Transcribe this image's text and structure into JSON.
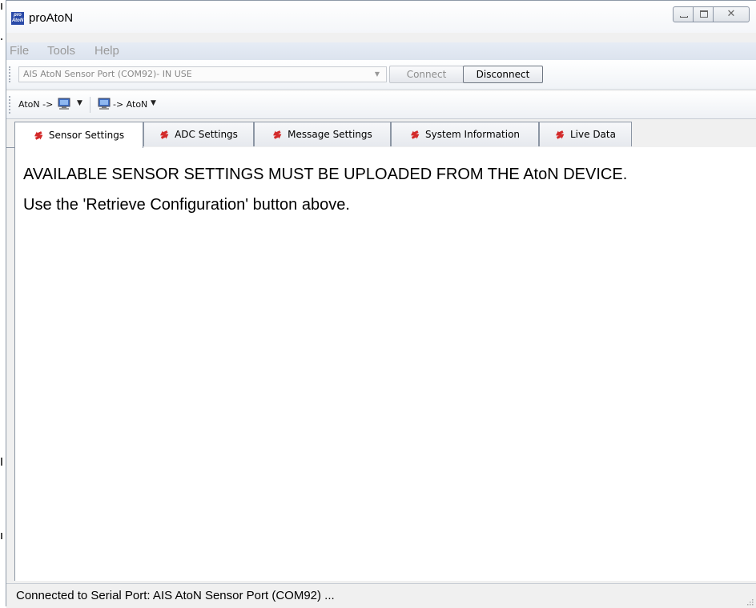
{
  "window": {
    "title": "proAtoN",
    "icon_text_top": "pro",
    "icon_text_bottom": "AtoN"
  },
  "menu": {
    "items": [
      "File",
      "Tools",
      "Help"
    ]
  },
  "connection_toolbar": {
    "port_value": "AIS AtoN Sensor Port (COM92)- IN USE",
    "connect_label": "Connect",
    "disconnect_label": "Disconnect"
  },
  "transfer_toolbar": {
    "download_label": "AtoN ->",
    "upload_label": "-> AtoN"
  },
  "tabs": [
    {
      "label": "Sensor Settings",
      "active": true
    },
    {
      "label": "ADC Settings",
      "active": false
    },
    {
      "label": "Message Settings",
      "active": false
    },
    {
      "label": "System Information",
      "active": false
    },
    {
      "label": "Live Data",
      "active": false
    }
  ],
  "content": {
    "line1": "AVAILABLE SENSOR SETTINGS MUST BE UPLOADED FROM THE AtoN DEVICE.",
    "line2": "Use the 'Retrieve Configuration' button above."
  },
  "status": {
    "text": "Connected to Serial Port: AIS AtoN Sensor Port (COM92) ..."
  },
  "colors": {
    "tab_icon": "#d32a2a",
    "app_icon": "#2a4aa8"
  }
}
